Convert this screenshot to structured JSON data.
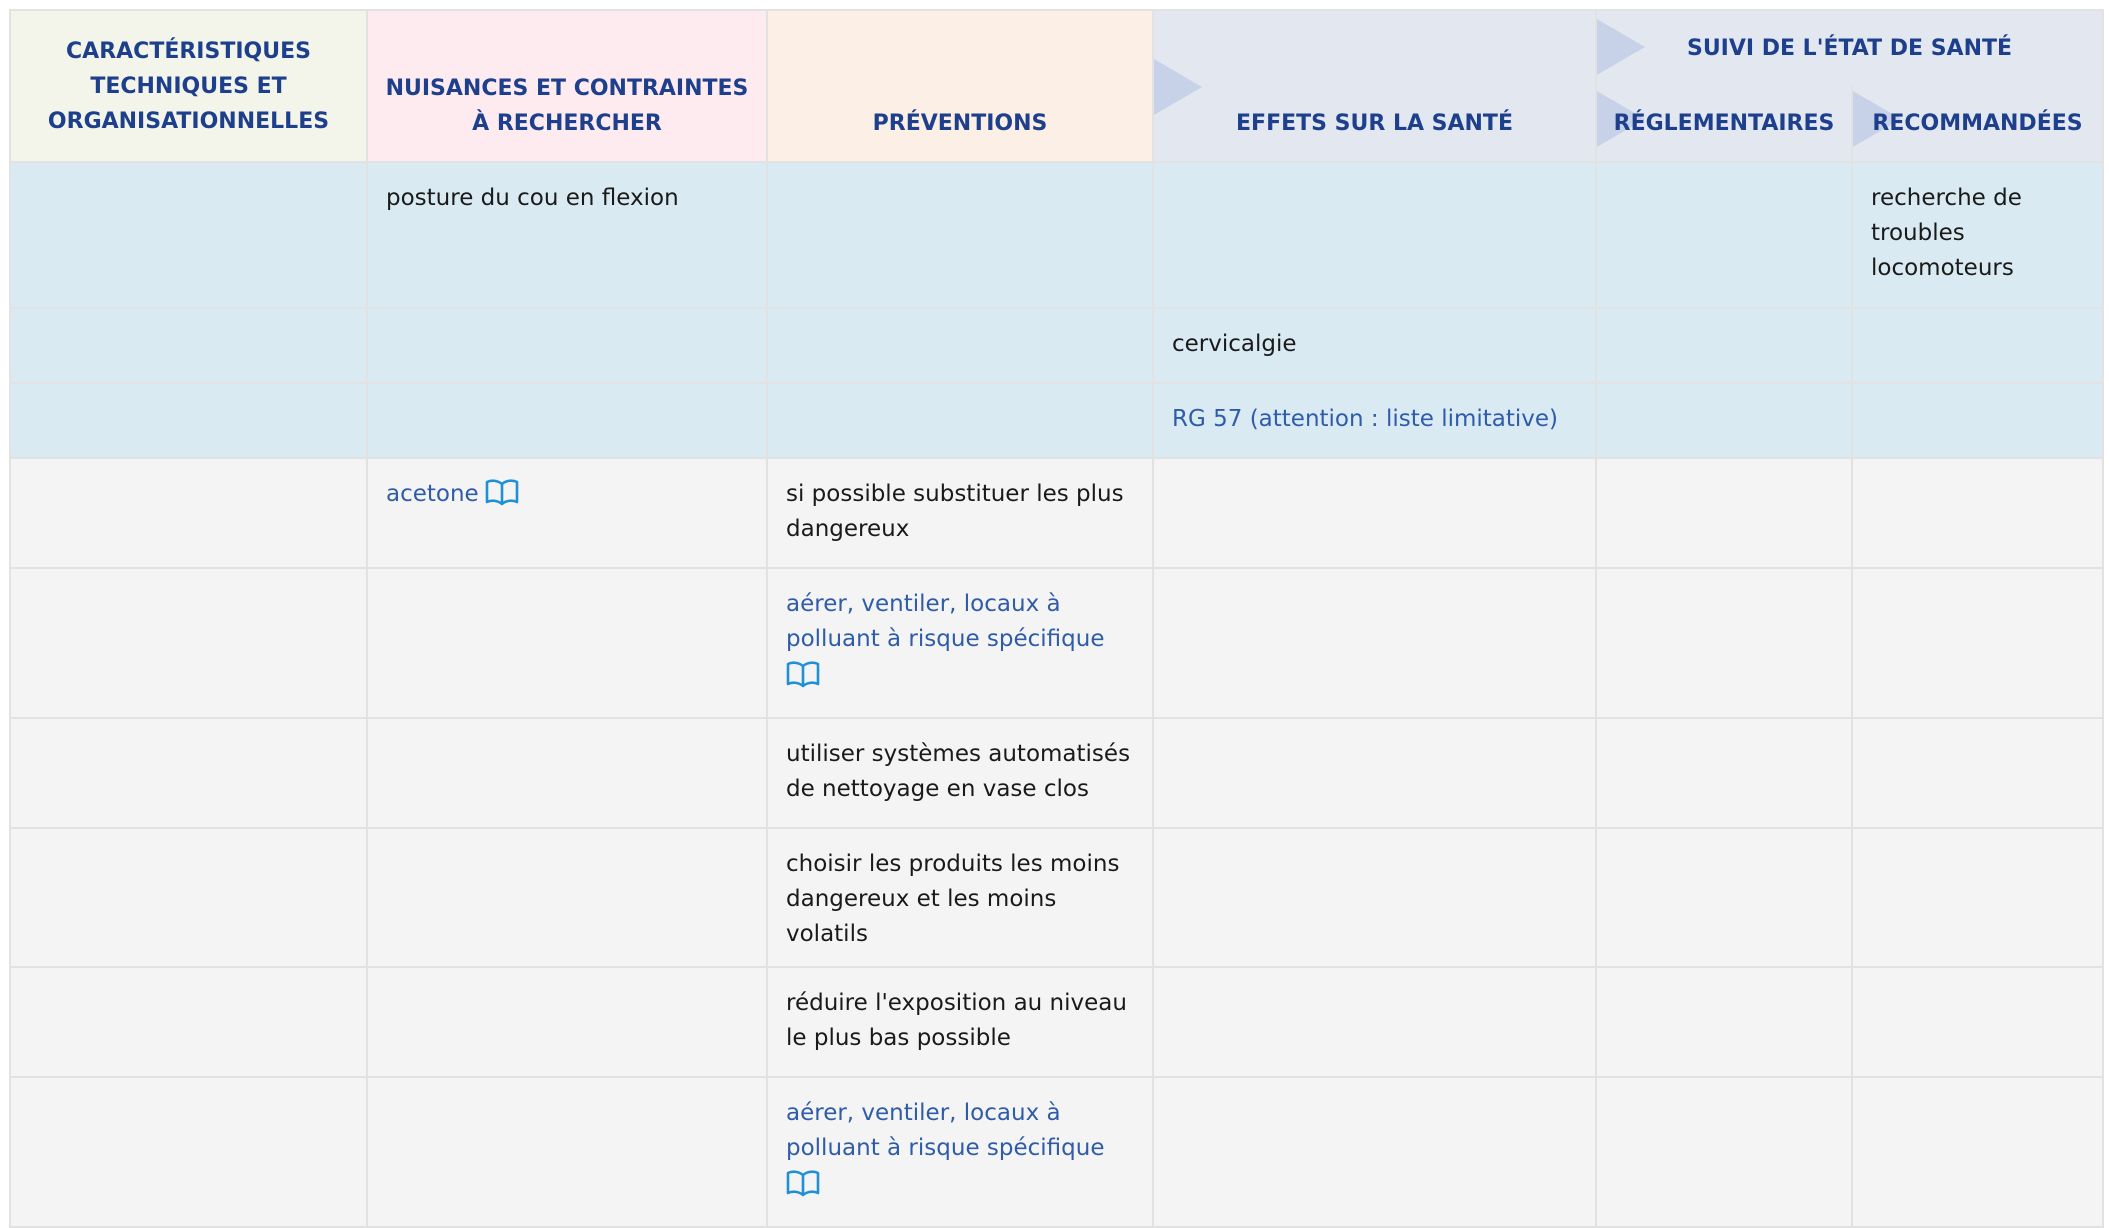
{
  "header": {
    "col1": [
      "CARACTÉRISTIQUES",
      "TECHNIQUES ET",
      "ORGANISATIONNELLES"
    ],
    "col2": [
      "NUISANCES ET CONTRAINTES",
      "À RECHERCHER"
    ],
    "col3": "PRÉVENTIONS",
    "col4": "EFFETS SUR LA SANTÉ",
    "group": "SUIVI DE L'ÉTAT DE SANTÉ",
    "col5": "RÉGLEMENTAIRES",
    "col6": "RECOMMANDÉES"
  },
  "rows": {
    "r1": {
      "nuisance": "posture du cou en flexion",
      "recommandees": [
        "recherche de",
        "troubles",
        "locomoteurs"
      ]
    },
    "r2": {
      "effets": "cervicalgie"
    },
    "r3": {
      "effets_link": "RG 57 (attention : liste limitative)"
    },
    "r4": {
      "nuisance_link": "acetone",
      "prevention": [
        "si possible substituer les plus",
        "dangereux"
      ]
    },
    "r5": {
      "prevention_link": [
        "aérer, ventiler, locaux à",
        "polluant à risque spécifique"
      ]
    },
    "r6": {
      "prevention": [
        "utiliser systèmes automatisés",
        "de nettoyage en vase clos"
      ]
    },
    "r7": {
      "prevention": [
        "choisir les produits les moins",
        "dangereux et les moins volatils"
      ]
    },
    "r8": {
      "prevention": [
        "réduire l'exposition au niveau",
        "le plus bas possible"
      ]
    },
    "r9": {
      "prevention_link": [
        "aérer, ventiler, locaux à",
        "polluant à risque spécifique"
      ]
    }
  },
  "icons": {
    "book": "book-icon"
  },
  "colors": {
    "header_text": "#1d3f8c",
    "link": "#2f5ca8",
    "book_icon": "#1f8fd6",
    "row_blue": "#daeaf2",
    "row_grey": "#f4f4f4",
    "head_crit": "#f3f5ea",
    "head_nuis": "#fdebf0",
    "head_prev": "#fcefe5",
    "head_effets": "#e3e8f0"
  }
}
